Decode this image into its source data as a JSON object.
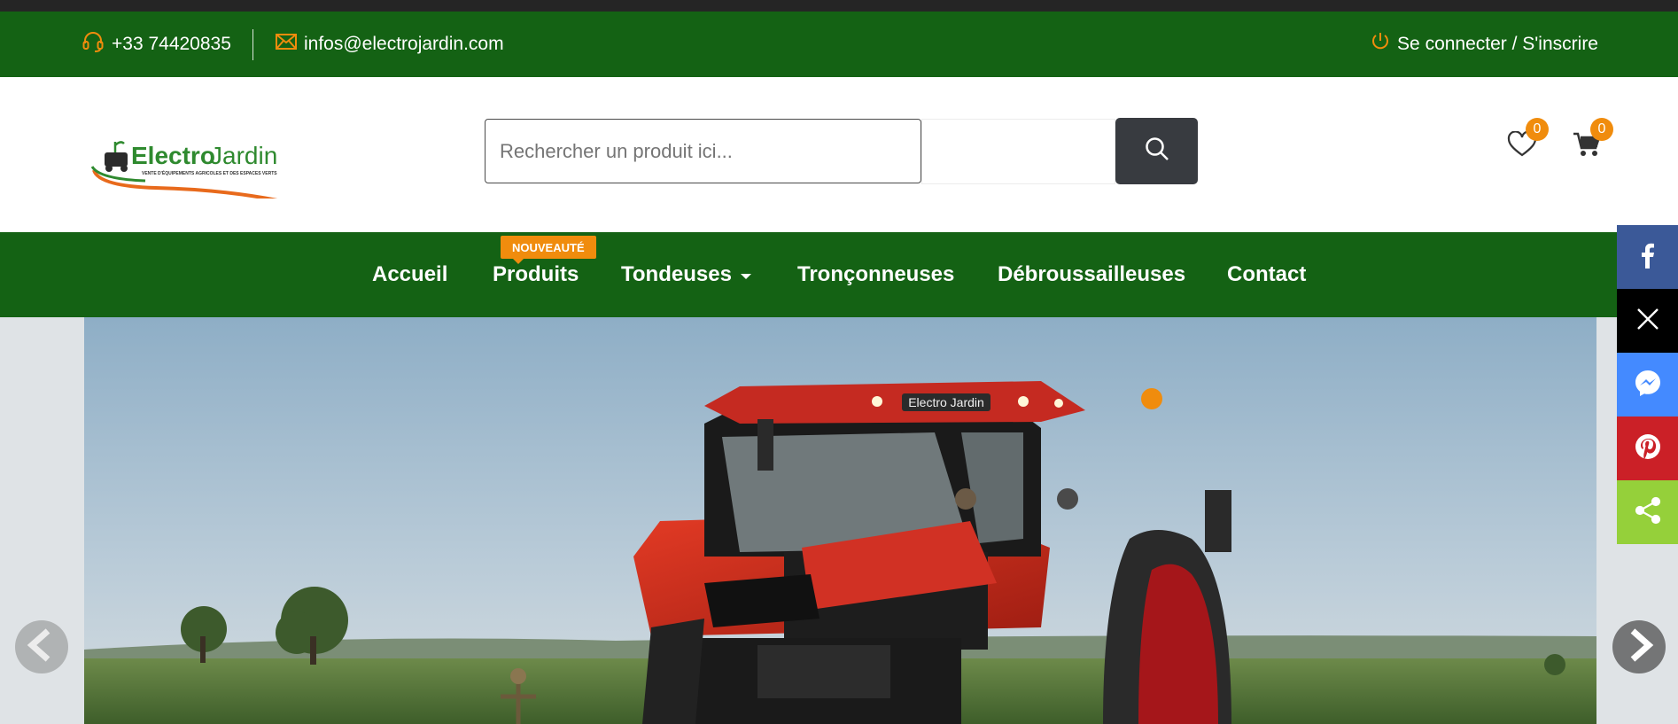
{
  "topbar": {
    "phone": "+33 74420835",
    "email": "infos@electrojardin.com",
    "login_label": "Se connecter / S'inscrire"
  },
  "logo": {
    "text_primary": "Electro",
    "text_secondary": "Jardin",
    "tagline": "VENTE D'ÉQUIPEMENTS AGRICOLES ET DES ESPACES VERTS"
  },
  "search": {
    "placeholder": "Rechercher un produit ici...",
    "value": ""
  },
  "header_icons": {
    "wishlist_count": "0",
    "cart_count": "0"
  },
  "nav": {
    "items": [
      {
        "label": "Accueil"
      },
      {
        "label": "Produits",
        "badge": "NOUVEAUTÉ"
      },
      {
        "label": "Tondeuses"
      },
      {
        "label": "Tronçonneuses"
      },
      {
        "label": "Débroussailleuses"
      },
      {
        "label": "Contact"
      }
    ]
  },
  "hero": {
    "cab_brand_text": "Electro Jardin"
  },
  "share": {
    "networks": [
      "facebook",
      "x",
      "messenger",
      "pinterest",
      "sharethis"
    ]
  },
  "colors": {
    "brand_green": "#146214",
    "accent_orange": "#f08c0d",
    "search_button": "#383b40",
    "facebook": "#3b5998",
    "x": "#000000",
    "messenger": "#448aff",
    "pinterest": "#cb2027",
    "share": "#95d03a"
  }
}
